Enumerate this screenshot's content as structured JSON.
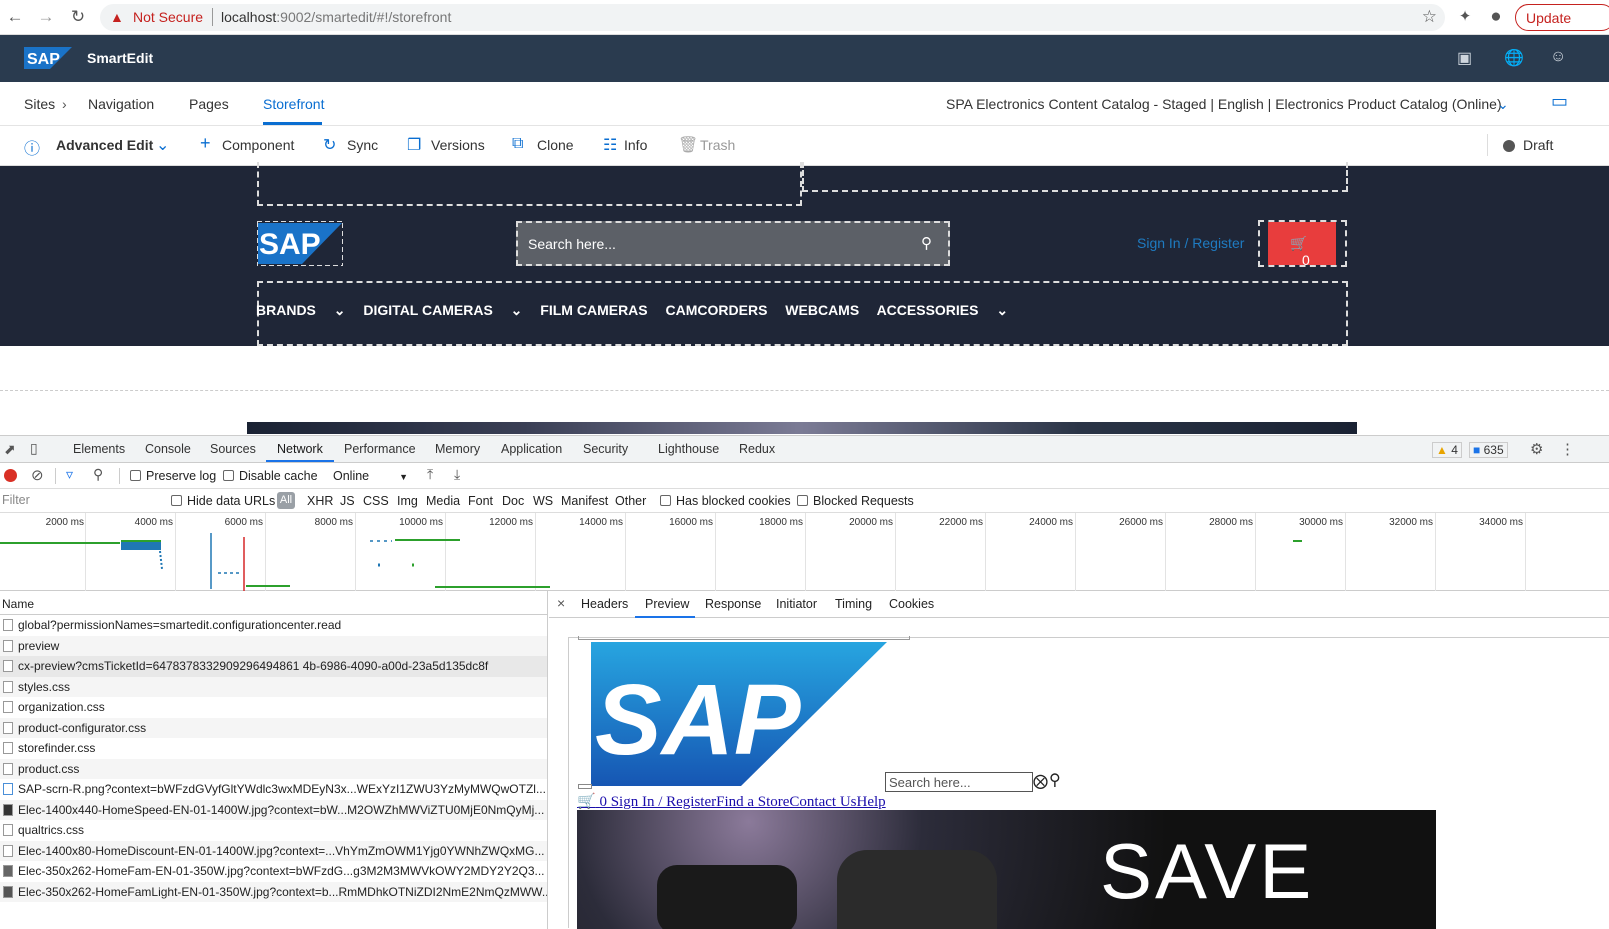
{
  "browser": {
    "security": "Not Secure",
    "url_host": "localhost",
    "url_rest": ":9002/smartedit/#!/storefront",
    "update_label": "Update"
  },
  "smartedit": {
    "title": "SmartEdit",
    "logo_text": "SAP"
  },
  "nav": {
    "sites": "Sites",
    "navigation": "Navigation",
    "pages": "Pages",
    "storefront": "Storefront",
    "catalog": "SPA Electronics Content Catalog - Staged | English | Electronics Product Catalog (Online)"
  },
  "toolbar": {
    "mode": "Advanced Edit",
    "component": "Component",
    "sync": "Sync",
    "versions": "Versions",
    "clone": "Clone",
    "info": "Info",
    "trash": "Trash",
    "status": "Draft"
  },
  "storefront": {
    "search_placeholder": "Search here...",
    "sign_in": "Sign In / Register",
    "cart_count": "0",
    "menu": [
      "BRANDS",
      "DIGITAL CAMERAS",
      "FILM CAMERAS",
      "CAMCORDERS",
      "WEBCAMS",
      "ACCESSORIES"
    ]
  },
  "devtools": {
    "tabs": [
      "Elements",
      "Console",
      "Sources",
      "Network",
      "Performance",
      "Memory",
      "Application",
      "Security",
      "Lighthouse",
      "Redux"
    ],
    "warnings": "4",
    "messages": "635",
    "preserve_log": "Preserve log",
    "disable_cache": "Disable cache",
    "throttle": "Online",
    "filter_placeholder": "Filter",
    "hide_data_urls": "Hide data URLs",
    "types": [
      "All",
      "XHR",
      "JS",
      "CSS",
      "Img",
      "Media",
      "Font",
      "Doc",
      "WS",
      "Manifest",
      "Other"
    ],
    "blocked_cookies": "Has blocked cookies",
    "blocked_requests": "Blocked Requests",
    "ticks": [
      "2000 ms",
      "4000 ms",
      "6000 ms",
      "8000 ms",
      "10000 ms",
      "12000 ms",
      "14000 ms",
      "16000 ms",
      "18000 ms",
      "20000 ms",
      "22000 ms",
      "24000 ms",
      "26000 ms",
      "28000 ms",
      "30000 ms",
      "32000 ms",
      "34000 ms"
    ],
    "name_header": "Name",
    "requests": [
      "global?permissionNames=smartedit.configurationcenter.read",
      "preview",
      "cx-preview?cmsTicketId=6478378332909296494861 4b-6986-4090-a00d-23a5d135dc8f",
      "styles.css",
      "organization.css",
      "product-configurator.css",
      "storefinder.css",
      "product.css",
      "SAP-scrn-R.png?context=bWFzdGVyfGltYWdlc3wxMDEyN3x...WExYzI1ZWU3YzMyMWQwOTZl...",
      "Elec-1400x440-HomeSpeed-EN-01-1400W.jpg?context=bW...M2OWZhMWViZTU0MjE0NmQyMj...",
      "qualtrics.css",
      "Elec-1400x80-HomeDiscount-EN-01-1400W.jpg?context=...VhYmZmOWM1Yjg0YWNhZWQxMG...",
      "Elec-350x262-HomeFam-EN-01-350W.jpg?context=bWFzdG...g3M2M3MWVkOWY2MDY2Y2Q3...",
      "Elec-350x262-HomeFamLight-EN-01-350W.jpg?context=b...RmMDhkOTNiZDI2NmE2NmQzMWW..."
    ],
    "preview_tabs": [
      "Headers",
      "Preview",
      "Response",
      "Initiator",
      "Timing",
      "Cookies"
    ],
    "preview": {
      "search_placeholder": "Search here...",
      "links": "0 Sign In / RegisterFind a StoreContact UsHelp",
      "banner_text": "SAVE"
    }
  }
}
